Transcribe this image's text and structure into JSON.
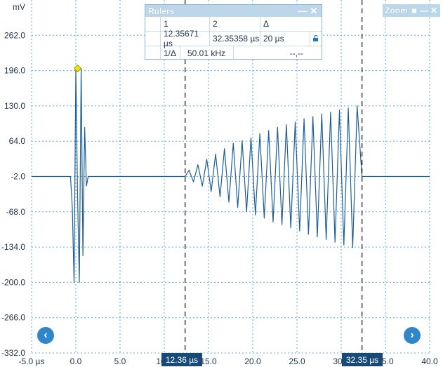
{
  "y_axis": {
    "unit": "mV",
    "ticks": [
      "262.0",
      "196.0",
      "130.0",
      "64.0",
      "-2.0",
      "-68.0",
      "-134.0",
      "-200.0",
      "-266.0",
      "-332.0"
    ]
  },
  "x_axis": {
    "ticks": [
      "-5.0 µs",
      "0.0",
      "5.0",
      "10.0",
      "15.0",
      "20.0",
      "25.0",
      "30.0",
      "35.0",
      "40.0"
    ]
  },
  "rulers_panel": {
    "title": "Rulers",
    "col1": "1",
    "col2": "2",
    "col_delta": "Δ",
    "r1_value": "12.35671 µs",
    "r2_value": "32.35358 µs",
    "delta_value": "20 µs",
    "inv_label": "1/Δ",
    "inv_value": "50.01 kHz",
    "extra_value": "--,--"
  },
  "zoom_panel": {
    "title": "Zoom"
  },
  "ruler_tags": {
    "r1": "12.36 µs",
    "r2": "32.35 µs"
  },
  "colors": {
    "trace": "#1f5e93",
    "grid": "#5aaedc",
    "tag": "#174a78",
    "marker": "#f2e600"
  },
  "chart_data": {
    "type": "line",
    "xlabel": "µs",
    "ylabel": "mV",
    "xlim": [
      -5.0,
      40.0
    ],
    "ylim": [
      -332.0,
      328.0
    ],
    "series": [
      {
        "x": [
          -5.0,
          -0.6,
          -0.4,
          -0.2,
          0.0,
          0.2,
          0.4,
          0.6,
          0.8,
          1.0,
          1.2,
          1.4,
          1.6,
          12.36,
          12.8,
          13.3,
          13.8,
          14.3,
          14.8,
          15.3,
          15.8,
          16.3,
          16.8,
          17.3,
          17.8,
          18.3,
          18.8,
          19.3,
          19.8,
          20.3,
          20.8,
          21.3,
          21.8,
          22.3,
          22.8,
          23.3,
          23.8,
          24.3,
          24.8,
          25.3,
          25.8,
          26.3,
          26.8,
          27.3,
          27.8,
          28.3,
          28.8,
          29.3,
          29.8,
          30.3,
          30.8,
          31.3,
          31.8,
          32.35,
          40.0
        ],
        "y": [
          -2,
          -2,
          -60,
          -200,
          200,
          -40,
          -200,
          200,
          -150,
          90,
          -20,
          -2,
          -2,
          -2,
          10,
          -12,
          20,
          -20,
          30,
          -30,
          40,
          -40,
          50,
          -50,
          60,
          -60,
          65,
          -68,
          70,
          -74,
          78,
          -80,
          84,
          -87,
          90,
          -92,
          95,
          -98,
          100,
          -104,
          106,
          -110,
          110,
          -115,
          115,
          -120,
          118,
          -125,
          122,
          -130,
          126,
          -135,
          130,
          -2,
          -2
        ]
      }
    ],
    "markers": [
      {
        "label": "",
        "x": 0.2,
        "y": 200
      }
    ],
    "rulers": [
      {
        "x": 12.35671
      },
      {
        "x": 32.35358
      }
    ]
  }
}
